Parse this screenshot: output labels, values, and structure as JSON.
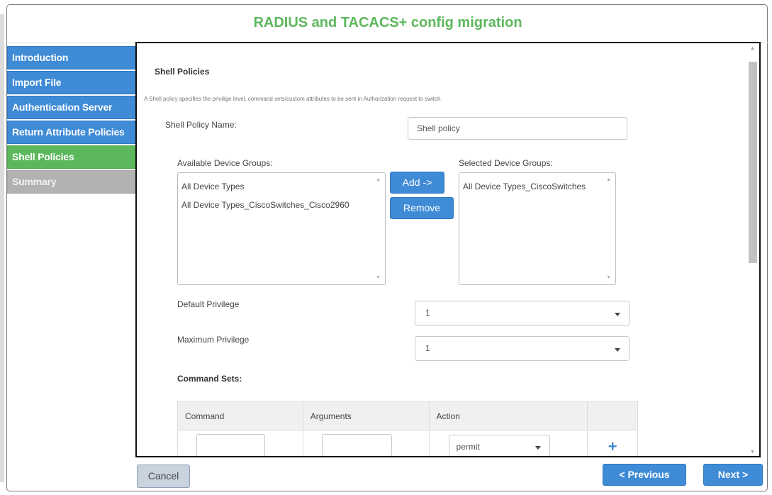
{
  "dialog": {
    "title": "RADIUS and TACACS+ config migration"
  },
  "sidebar": {
    "items": [
      {
        "label": "Introduction",
        "state": "blue"
      },
      {
        "label": "Import File",
        "state": "blue"
      },
      {
        "label": "Authentication Server",
        "state": "blue"
      },
      {
        "label": "Return Attribute Policies",
        "state": "blue"
      },
      {
        "label": "Shell Policies",
        "state": "active"
      },
      {
        "label": "Summary",
        "state": "disabled"
      }
    ]
  },
  "main": {
    "section_title": "Shell Policies",
    "description": "A Shell policy specifies the privilige level, command sets/custom attributes to be sent in Authorization request to switch.",
    "policy_name_label": "Shell Policy Name:",
    "policy_name_value": "Shell policy",
    "available_groups_label": "Available Device Groups:",
    "available_groups": [
      "All Device Types",
      "All Device Types_CiscoSwitches_Cisco2960"
    ],
    "selected_groups_label": "Selected Device Groups:",
    "selected_groups": [
      "All Device Types_CiscoSwitches"
    ],
    "add_button": "Add ->",
    "remove_button": "Remove",
    "default_privilege_label": "Default Privilege",
    "default_privilege_value": "1",
    "maximum_privilege_label": "Maximum Privilege",
    "maximum_privilege_value": "1",
    "command_sets_label": "Command Sets:",
    "command_table": {
      "headers": [
        "Command",
        "Arguments",
        "Action",
        ""
      ],
      "action_value": "permit"
    }
  },
  "footer": {
    "cancel": "Cancel",
    "previous": "< Previous",
    "next": "Next >"
  },
  "colors": {
    "title_green": "#5cb85c",
    "nav_blue": "#3f8bd6",
    "nav_active": "#5cb85c",
    "nav_disabled": "#b2b2b2"
  }
}
